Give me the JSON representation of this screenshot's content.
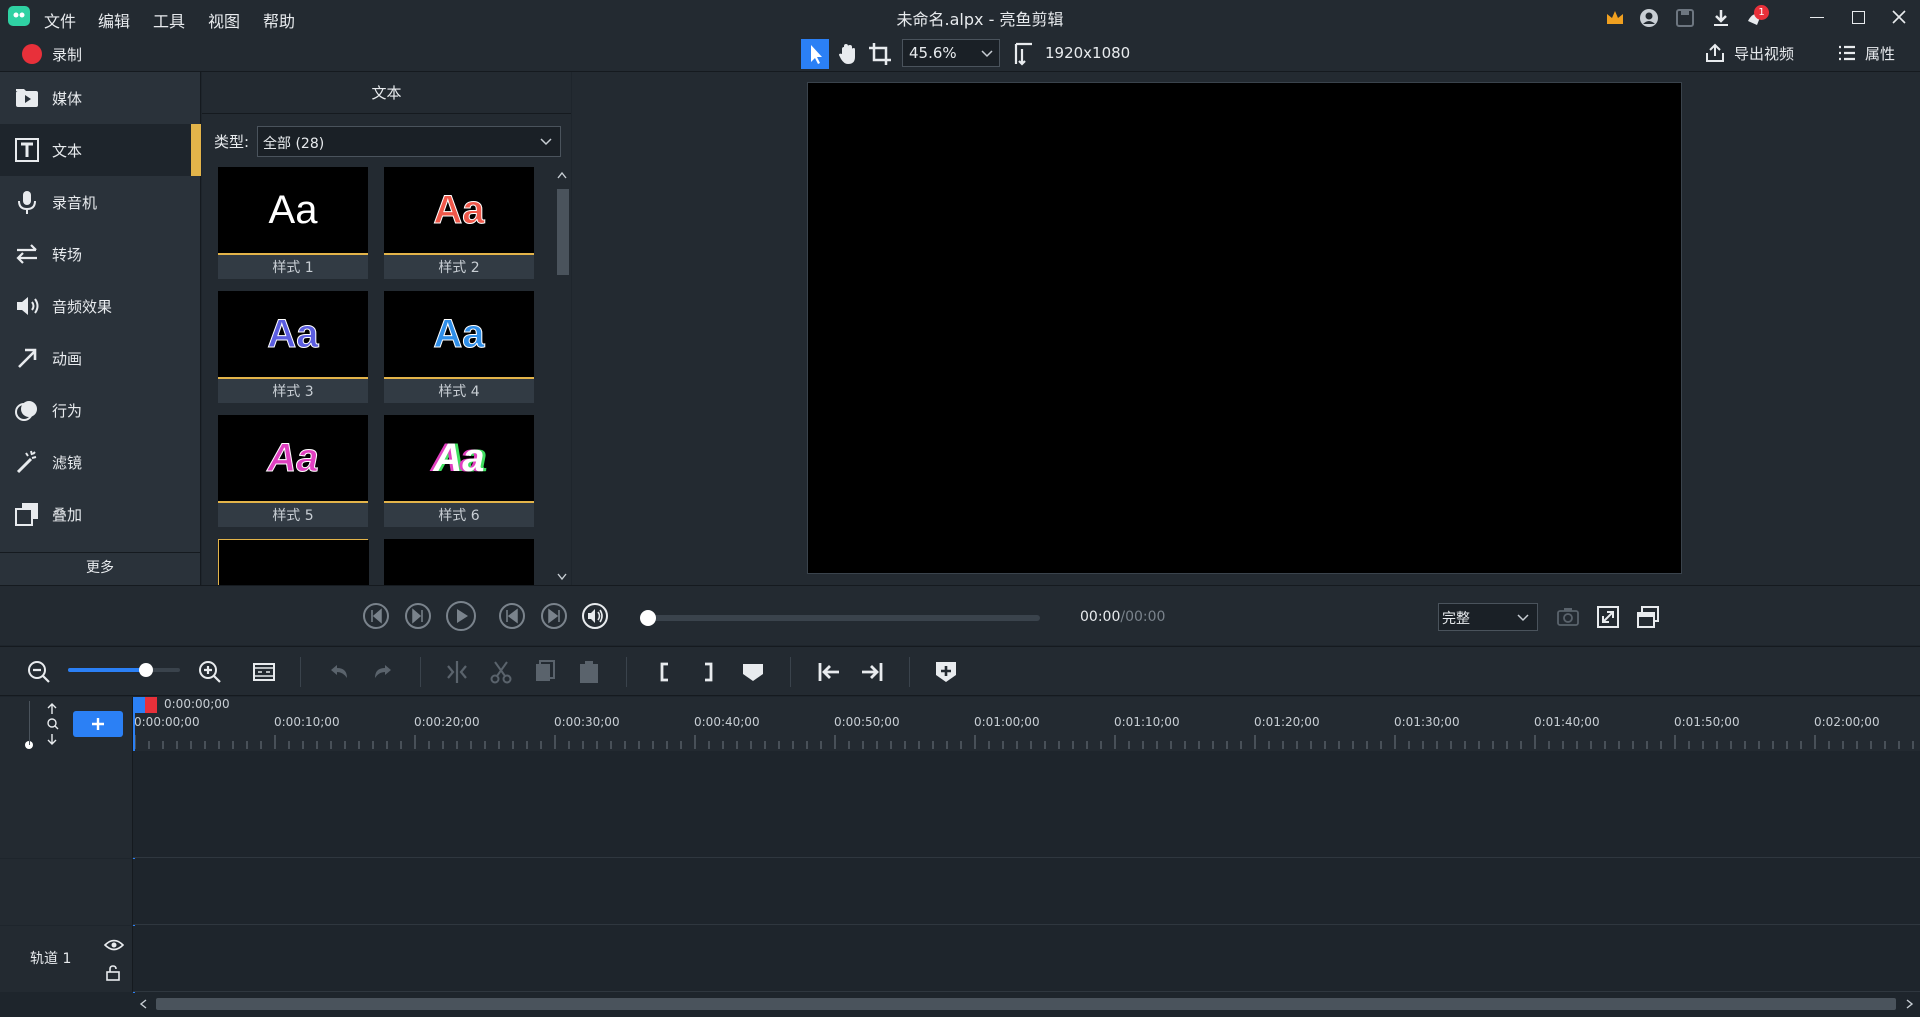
{
  "window": {
    "title": "未命名.alpx - 亮鱼剪辑",
    "notification_count": "1"
  },
  "menu": [
    "文件",
    "编辑",
    "工具",
    "视图",
    "帮助"
  ],
  "toolbar": {
    "record_label": "录制",
    "zoom_value": "45.6%",
    "resolution": "1920x1080",
    "export_label": "导出视频",
    "properties_label": "属性"
  },
  "sidebar": {
    "items": [
      {
        "label": "媒体",
        "icon": "media-icon"
      },
      {
        "label": "文本",
        "icon": "text-icon"
      },
      {
        "label": "录音机",
        "icon": "microphone-icon"
      },
      {
        "label": "转场",
        "icon": "transition-icon"
      },
      {
        "label": "音频效果",
        "icon": "speaker-icon"
      },
      {
        "label": "动画",
        "icon": "arrow-icon"
      },
      {
        "label": "行为",
        "icon": "behavior-icon"
      },
      {
        "label": "滤镜",
        "icon": "magic-wand-icon"
      },
      {
        "label": "叠加",
        "icon": "overlay-icon"
      }
    ],
    "active_index": 1,
    "more_label": "更多"
  },
  "panel": {
    "title": "文本",
    "type_label": "类型:",
    "type_value": "全部 (28)",
    "styles": [
      {
        "caption": "样式 1",
        "sample": "Aa"
      },
      {
        "caption": "样式 2",
        "sample": "Aa"
      },
      {
        "caption": "样式 3",
        "sample": "Aa"
      },
      {
        "caption": "样式 4",
        "sample": "Aa"
      },
      {
        "caption": "样式 5",
        "sample": "Aa"
      },
      {
        "caption": "样式 6",
        "sample": "Aa"
      }
    ]
  },
  "player": {
    "time_current": "00:00",
    "time_total": "/00:00",
    "quality": "完整",
    "progress": 0
  },
  "timeline": {
    "zoom_level": 0.7,
    "playhead_time": "0:00:00;00",
    "ruler_labels": [
      "0:00:00;00",
      "0:00:10;00",
      "0:00:20;00",
      "0:00:30;00",
      "0:00:40;00",
      "0:00:50;00",
      "0:01:00;00",
      "0:01:10;00",
      "0:01:20;00",
      "0:01:30;00",
      "0:01:40;00",
      "0:01:50;00",
      "0:02:00;00"
    ],
    "track_label": "轨道 1"
  },
  "colors": {
    "accent": "#e3b44a",
    "blue": "#2b80f5",
    "record_red": "#e8303a",
    "background": "#1e252c"
  }
}
